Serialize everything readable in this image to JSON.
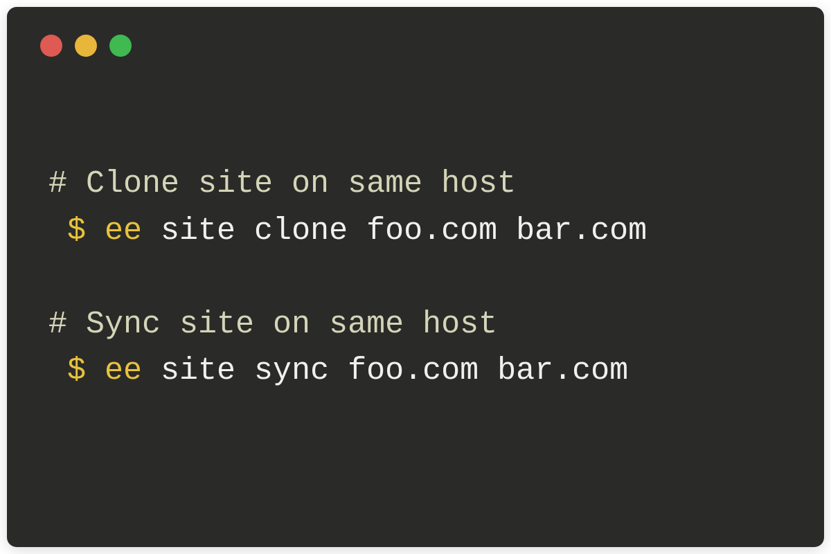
{
  "colors": {
    "background": "#2a2a28",
    "red": "#de5a52",
    "yellow": "#e8b63b",
    "green": "#3fb950",
    "comment": "#d4d4b8",
    "prompt": "#e8c23c",
    "command": "#e8c23c",
    "args": "#f0f0ee"
  },
  "lines": [
    {
      "type": "comment",
      "text": "# Clone site on same host"
    },
    {
      "type": "command",
      "prompt": " $ ",
      "cmd": "ee",
      "args": " site clone foo.com bar.com"
    },
    {
      "type": "blank"
    },
    {
      "type": "comment",
      "text": "# Sync site on same host"
    },
    {
      "type": "command",
      "prompt": " $ ",
      "cmd": "ee",
      "args": " site sync foo.com bar.com"
    }
  ]
}
